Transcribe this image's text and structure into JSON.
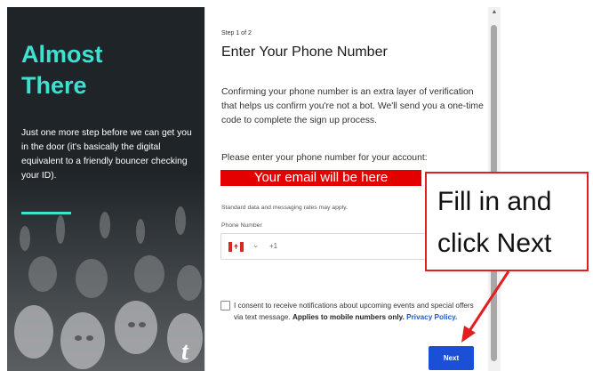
{
  "left_panel": {
    "heading_line1": "Almost",
    "heading_line2": "There",
    "body": "Just one more step before we can get you in the door (it's basically the digital equivalent to a friendly bouncer checking your ID).",
    "brand_mark": "t",
    "accent_color": "#3ee0d2"
  },
  "form": {
    "step": "Step 1 of 2",
    "title": "Enter Your Phone Number",
    "description": "Confirming your phone number is an extra layer of verification that helps us confirm you're not a bot. We'll send you a one-time code to complete the sign up process.",
    "prompt": "Please enter your phone number for your account:",
    "email_placeholder": "Your email will be here",
    "rates_note": "Standard data and messaging rates may apply.",
    "phone_label": "Phone Number",
    "country": "Canada",
    "dial_code": "+1",
    "consent_text": "I consent to receive notifications about upcoming events and special offers via text message.",
    "consent_bold": "Applies to mobile numbers only.",
    "privacy_link": "Privacy Policy.",
    "next_label": "Next",
    "button_color": "#1b4fd8"
  },
  "annotation": {
    "callout_text": "Fill in and click Next",
    "color": "#e02020"
  },
  "icons": [
    "canada-flag-icon",
    "chevron-down-icon",
    "scroll-up-icon",
    "arrow-annotation-icon",
    "brand-logo-icon"
  ]
}
